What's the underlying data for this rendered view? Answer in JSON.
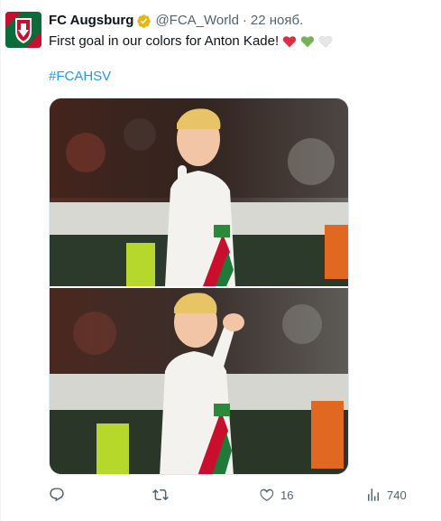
{
  "tweet": {
    "author_name": "FC Augsburg",
    "handle": "@FCA_World",
    "separator": "·",
    "date": "22 нояб.",
    "text": "First goal in our colors for Anton Kade!",
    "hashtag": "#FCAHSV",
    "hearts": [
      "red-heart-icon",
      "green-heart-icon",
      "white-heart-icon"
    ]
  },
  "actions": {
    "reply_count": "",
    "retweet_count": "",
    "like_count": "16",
    "views_count": "740"
  },
  "colors": {
    "link": "#1d9bf0",
    "muted": "#536471",
    "verified": "#e2b719",
    "heart_red": "#dd2e44",
    "heart_green": "#78b159",
    "heart_white": "#e6e7e8",
    "fca_green": "#0b6b3a",
    "fca_red": "#c8102e"
  }
}
